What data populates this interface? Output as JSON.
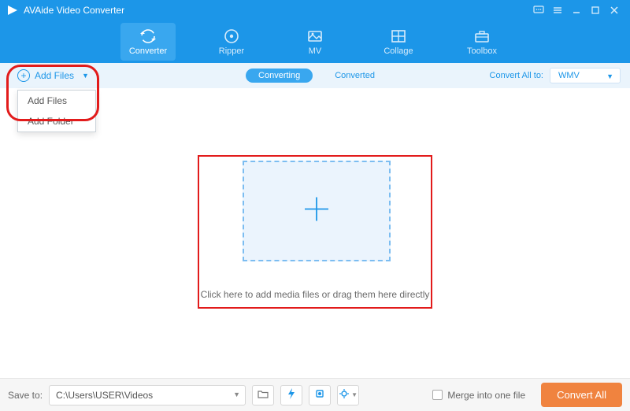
{
  "titlebar": {
    "app_name": "AVAide Video Converter"
  },
  "nav": {
    "items": [
      {
        "label": "Converter",
        "icon": "swap-icon",
        "active": true
      },
      {
        "label": "Ripper",
        "icon": "disc-icon"
      },
      {
        "label": "MV",
        "icon": "image-icon"
      },
      {
        "label": "Collage",
        "icon": "grid-icon"
      },
      {
        "label": "Toolbox",
        "icon": "toolbox-icon"
      }
    ]
  },
  "subbar": {
    "add_files_label": "Add Files",
    "dropdown": {
      "items": [
        "Add Files",
        "Add Folder"
      ]
    },
    "tabs": {
      "converting": "Converting",
      "converted": "Converted"
    },
    "convert_all_to_label": "Convert All to:",
    "format_selected": "WMV"
  },
  "workspace": {
    "caption": "Click here to add media files or drag them here directly"
  },
  "bottombar": {
    "save_to_label": "Save to:",
    "path_value": "C:\\Users\\USER\\Videos",
    "merge_label": "Merge into one file",
    "convert_all_label": "Convert All"
  }
}
